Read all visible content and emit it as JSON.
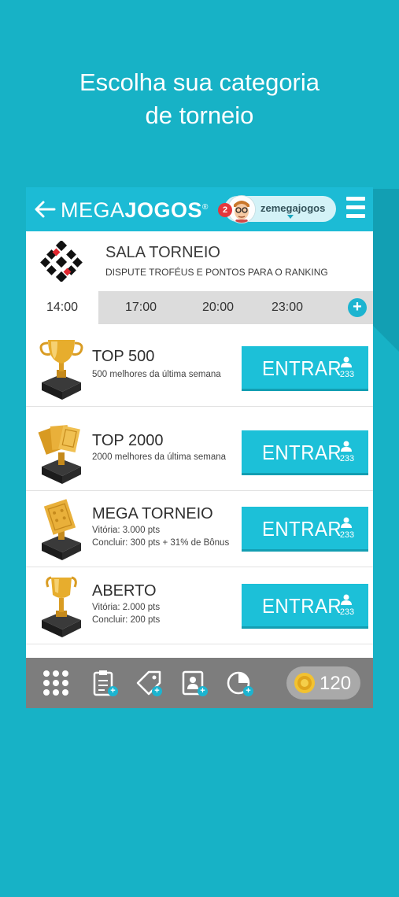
{
  "headline": {
    "line1": "Escolha sua categoria",
    "line2": "de torneio"
  },
  "topbar": {
    "back_icon": "arrow-left-icon",
    "logo_part1": "MEGA",
    "logo_part2": "JOGOS",
    "logo_mark": "®",
    "username": "zemegajogos",
    "notification_count": "2",
    "menu_icon": "hamburger-icon"
  },
  "room": {
    "title": "SALA TORNEIO",
    "subtitle": "DISPUTE TROFÉUS E PONTOS PARA O RANKING",
    "icon": "card-suits-icon"
  },
  "tabs": [
    {
      "label": "14:00",
      "active": true
    },
    {
      "label": "17:00",
      "active": false
    },
    {
      "label": "20:00",
      "active": false
    },
    {
      "label": "23:00",
      "active": false
    }
  ],
  "tab_add": "+",
  "tournaments": [
    {
      "title": "TOP 500",
      "lines": [
        "500 melhores da última semana"
      ],
      "button": "ENTRAR",
      "players": "233",
      "icon": "gold-cup-trophy-icon"
    },
    {
      "title": "TOP 2000",
      "lines": [
        "2000 melhores da última semana"
      ],
      "button": "ENTRAR",
      "players": "233",
      "icon": "gold-cards-trophy-icon"
    },
    {
      "title": "MEGA TORNEIO",
      "lines": [
        "Vitória: 3.000 pts",
        "Concluir: 300 pts  +  31% de Bônus"
      ],
      "button": "ENTRAR",
      "players": "233",
      "icon": "gold-card-trophy-icon"
    },
    {
      "title": "ABERTO",
      "lines": [
        "Vitória: 2.000 pts",
        "Concluir: 200 pts"
      ],
      "button": "ENTRAR",
      "players": "233",
      "icon": "gold-goblet-trophy-icon"
    }
  ],
  "bottombar": {
    "icons": [
      "grid-icon",
      "clipboard-plus-icon",
      "tag-plus-icon",
      "id-card-plus-icon",
      "pie-chart-plus-icon"
    ],
    "coin_icon": "coin-icon",
    "coins": "120"
  },
  "colors": {
    "background": "#17b2c6",
    "topbar": "#1cbbd5",
    "button": "#1cc0d8",
    "bottombar": "#7d7d7d"
  }
}
